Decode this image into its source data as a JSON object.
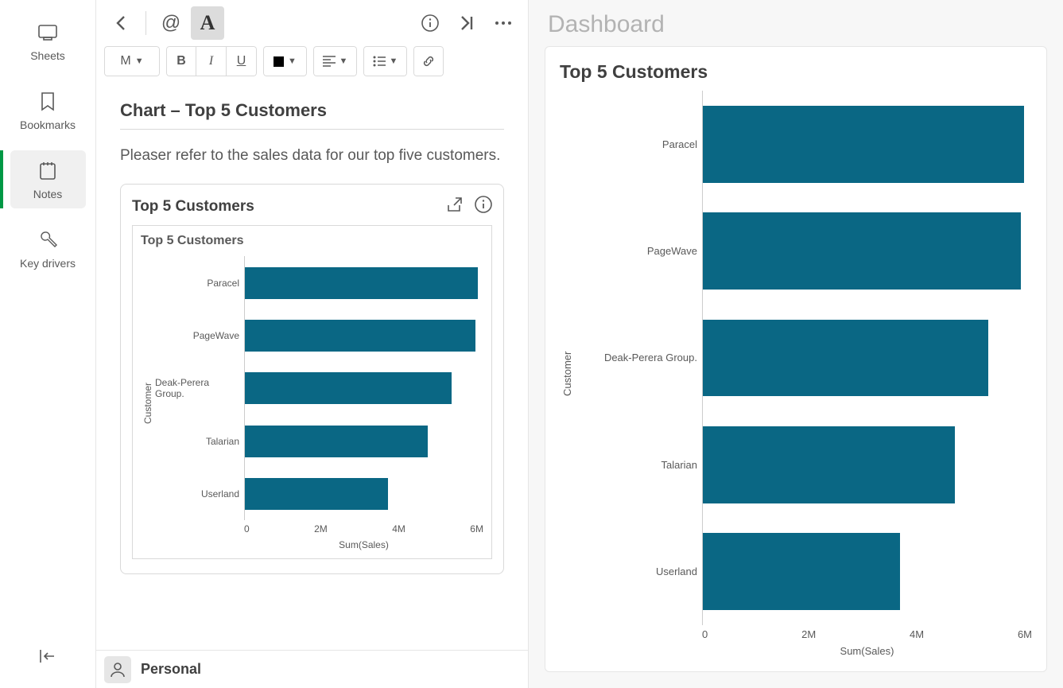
{
  "sidebar": {
    "items": [
      {
        "label": "Sheets"
      },
      {
        "label": "Bookmarks"
      },
      {
        "label": "Notes"
      },
      {
        "label": "Key drivers"
      }
    ]
  },
  "toolbar": {
    "mention": "@",
    "text_format": "A",
    "heading": "M"
  },
  "note": {
    "title": "Chart – Top 5 Customers",
    "body": "Pleaser refer to the sales data for our top five customers.",
    "card_title": "Top 5 Customers",
    "inner_title": "Top 5 Customers"
  },
  "footer": {
    "owner": "Personal"
  },
  "dashboard": {
    "title": "Dashboard",
    "card_title": "Top 5 Customers"
  },
  "chart_data": {
    "type": "bar",
    "orientation": "horizontal",
    "title": "Top 5 Customers",
    "ylabel": "Customer",
    "xlabel": "Sum(Sales)",
    "xlim": [
      0,
      6000000
    ],
    "ticks": [
      "0",
      "2M",
      "4M",
      "6M"
    ],
    "categories": [
      "Paracel",
      "PageWave",
      "Deak-Perera Group.",
      "Talarian",
      "Userland"
    ],
    "values": [
      5850000,
      5800000,
      5200000,
      4600000,
      3600000
    ],
    "color": "#0a6784"
  }
}
